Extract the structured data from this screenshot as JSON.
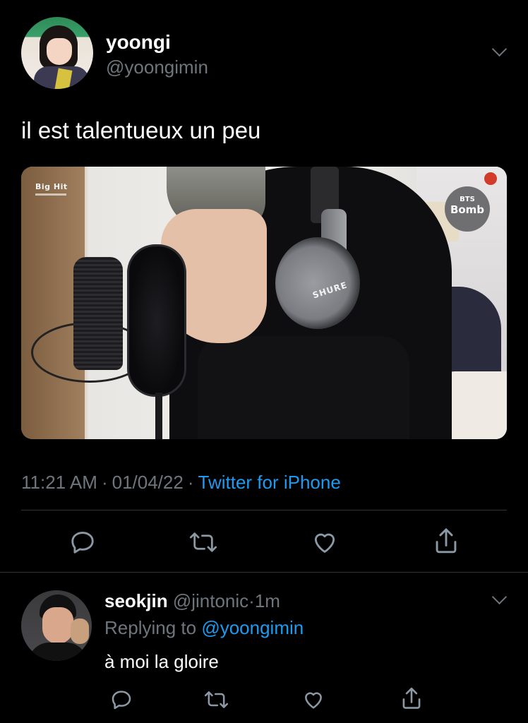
{
  "main_tweet": {
    "display_name": "yoongi",
    "handle": "@yoongimin",
    "text": "il est talentueux un peu",
    "media": {
      "watermark_left": "Big Hit",
      "badge_line1": "BTS",
      "badge_line2": "Bomb",
      "headphone_brand": "SHURE"
    },
    "time": "11:21 AM",
    "date": "01/04/22",
    "source": "Twitter for iPhone",
    "separator": "·"
  },
  "reply_tweet": {
    "display_name": "seokjin",
    "handle": "@jintonic",
    "time_ago": "1m",
    "separator": "·",
    "replying_prefix": "Replying to",
    "replying_to": "@yoongimin",
    "text": "à moi la gloire"
  },
  "icons": [
    "reply-icon",
    "retweet-icon",
    "like-icon",
    "share-icon",
    "chevron-down-icon"
  ],
  "colors": {
    "background": "#000000",
    "text": "#ffffff",
    "muted": "#6e767d",
    "link": "#1d9bf0",
    "divider": "#2f3336"
  }
}
